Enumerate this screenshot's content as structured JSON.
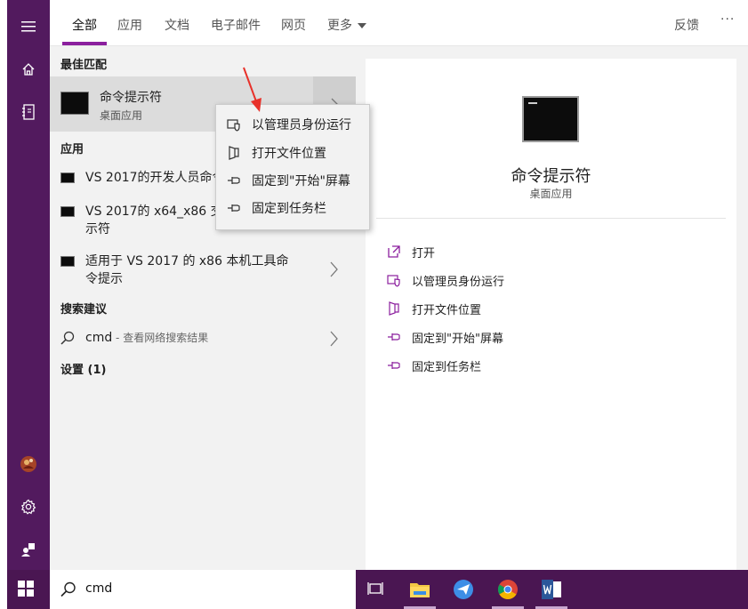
{
  "tabs": {
    "all": "全部",
    "apps": "应用",
    "documents": "文档",
    "email": "电子邮件",
    "web": "网页",
    "more": "更多",
    "feedback": "反馈",
    "overflow": "···"
  },
  "results": {
    "best_match_header": "最佳匹配",
    "best_match": {
      "title": "命令提示符",
      "subtitle": "桌面应用"
    },
    "apps_header": "应用",
    "apps": [
      {
        "label": "VS 2017的开发人员命令提示符"
      },
      {
        "label": "VS 2017的 x64_x86 交叉工具命令提示符"
      },
      {
        "label": "适用于 VS 2017 的 x86 本机工具命令提示"
      }
    ],
    "suggestions_header": "搜索建议",
    "suggestion": {
      "query": "cmd",
      "hint": " - 查看网络搜索结果"
    },
    "settings_header": "设置 (1)"
  },
  "context_menu": {
    "run_as_admin": "以管理员身份运行",
    "open_location": "打开文件位置",
    "pin_start": "固定到\"开始\"屏幕",
    "pin_taskbar": "固定到任务栏"
  },
  "preview": {
    "title": "命令提示符",
    "subtitle": "桌面应用",
    "actions": {
      "open": "打开",
      "run_as_admin": "以管理员身份运行",
      "open_location": "打开文件位置",
      "pin_start": "固定到\"开始\"屏幕",
      "pin_taskbar": "固定到任务栏"
    }
  },
  "taskbar": {
    "search_value": "cmd"
  },
  "colors": {
    "rail": "#521a5e",
    "accent": "#8b1f9e",
    "taskbar": "#4a1652",
    "pane": "#f2f2f2",
    "selected": "#dcdcdc",
    "annotation_arrow": "#e8312a"
  }
}
